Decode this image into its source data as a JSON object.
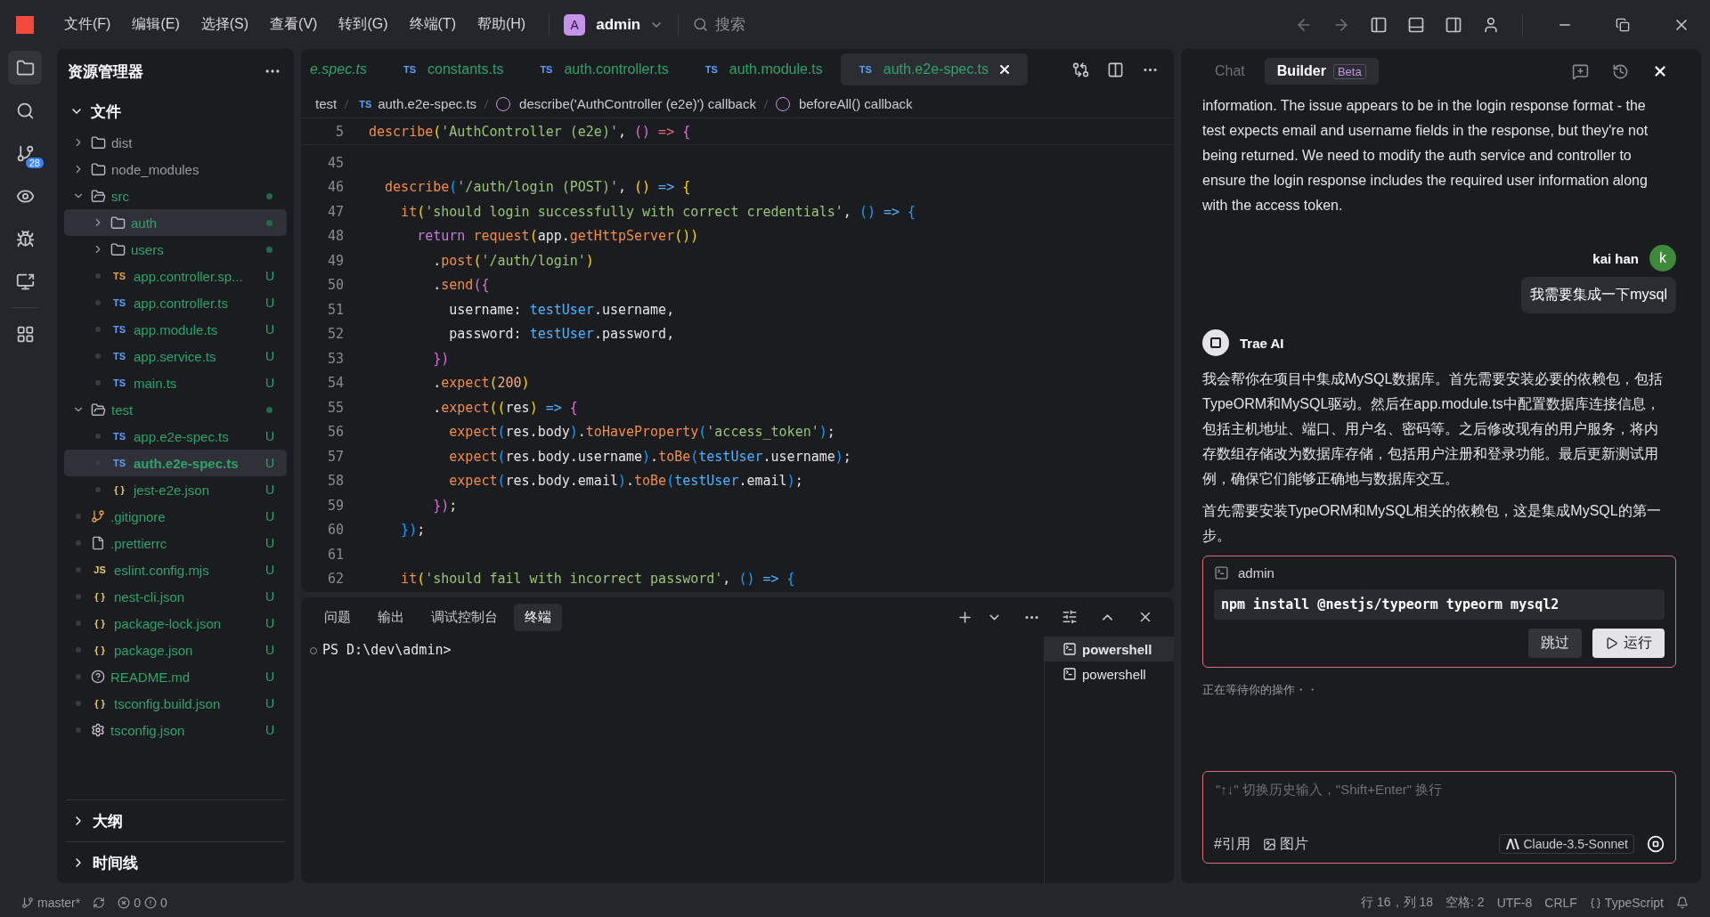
{
  "title_bar": {
    "menus": [
      "文件(F)",
      "编辑(E)",
      "选择(S)",
      "查看(V)",
      "转到(G)",
      "终端(T)",
      "帮助(H)"
    ],
    "project": {
      "avatar": "A",
      "name": "admin"
    },
    "search": {
      "placeholder": "搜索"
    }
  },
  "activity_bar": [
    {
      "kind": "files",
      "selected": true
    },
    {
      "kind": "search",
      "selected": false
    },
    {
      "kind": "git",
      "selected": false,
      "badge": "28"
    },
    {
      "kind": "watch",
      "selected": false
    },
    {
      "kind": "debug",
      "selected": false
    },
    {
      "kind": "remote",
      "selected": false
    },
    {
      "kind": "extensions",
      "selected": false
    }
  ],
  "explorer": {
    "title": "资源管理器",
    "sections": [
      {
        "label": "文件",
        "expanded": true,
        "items": [
          {
            "name": "dist",
            "kind": "folder",
            "expanded": false,
            "selected": false
          },
          {
            "name": "node_modules",
            "kind": "folder",
            "expanded": false,
            "selected": false
          },
          {
            "name": "src",
            "kind": "folder",
            "expanded": true,
            "selected": false,
            "dot": true,
            "children": [
              {
                "name": "auth",
                "kind": "folder",
                "expanded": false,
                "selected": true,
                "dot": true
              },
              {
                "name": "users",
                "kind": "folder",
                "expanded": false,
                "selected": false,
                "dot": true
              },
              {
                "name": "app.controller.sp...",
                "kind": "test",
                "icon": "TS",
                "selected": false,
                "badge": "U"
              },
              {
                "name": "app.controller.ts",
                "kind": "code",
                "icon": "TS",
                "selected": false,
                "badge": "U"
              },
              {
                "name": "app.module.ts",
                "kind": "code",
                "icon": "TS",
                "selected": false,
                "badge": "U"
              },
              {
                "name": "app.service.ts",
                "kind": "code",
                "icon": "TS",
                "selected": false,
                "badge": "U"
              },
              {
                "name": "main.ts",
                "kind": "code",
                "icon": "TS",
                "selected": false,
                "badge": "U"
              }
            ]
          },
          {
            "name": "test",
            "kind": "folder",
            "expanded": true,
            "selected": false,
            "dot": true,
            "children": [
              {
                "name": "app.e2e-spec.ts",
                "kind": "code",
                "icon": "TS",
                "selected": false,
                "badge": "U"
              },
              {
                "name": "auth.e2e-spec.ts",
                "kind": "code",
                "icon": "TS",
                "selected": true,
                "badge": "U"
              },
              {
                "name": "jest-e2e.json",
                "kind": "json",
                "icon": "{ }",
                "selected": false,
                "badge": "U"
              }
            ]
          },
          {
            "name": ".gitignore",
            "kind": "git",
            "selected": false,
            "badge": "U"
          },
          {
            "name": ".prettierrc",
            "kind": "file",
            "selected": false,
            "badge": "U"
          },
          {
            "name": "eslint.config.mjs",
            "kind": "json",
            "icon": "JS",
            "selected": false,
            "badge": "U"
          },
          {
            "name": "nest-cli.json",
            "kind": "json",
            "icon": "{ }",
            "selected": false,
            "badge": "U"
          },
          {
            "name": "package-lock.json",
            "kind": "json",
            "icon": "{ }",
            "selected": false,
            "badge": "U"
          },
          {
            "name": "package.json",
            "kind": "json",
            "icon": "{ }",
            "selected": false,
            "badge": "U"
          },
          {
            "name": "README.md",
            "kind": "readme",
            "selected": false,
            "badge": "U"
          },
          {
            "name": "tsconfig.build.json",
            "kind": "json",
            "icon": "{ }",
            "selected": false,
            "badge": "U"
          },
          {
            "name": "tsconfig.json",
            "kind": "gear",
            "selected": false,
            "badge": "U"
          }
        ]
      },
      {
        "label": "大纲",
        "expanded": false
      },
      {
        "label": "时间线",
        "expanded": false
      }
    ]
  },
  "editor": {
    "tabs": [
      {
        "label": "e.spec.ts",
        "selected": false
      },
      {
        "icon": "TS",
        "label": "constants.ts",
        "selected": false
      },
      {
        "icon": "TS",
        "label": "auth.controller.ts",
        "selected": false
      },
      {
        "icon": "TS",
        "label": "auth.module.ts",
        "selected": false
      },
      {
        "icon": "TS",
        "label": "auth.e2e-spec.ts",
        "selected": true
      }
    ],
    "breadcrumb": [
      {
        "kind": "folder",
        "label": "test"
      },
      {
        "kind": "file",
        "icon": "TS",
        "label": "auth.e2e-spec.ts"
      },
      {
        "kind": "function",
        "label": "describe('AuthController (e2e)') callback"
      },
      {
        "kind": "function",
        "label": "beforeAll() callback"
      }
    ],
    "sticky_line": {
      "num": "5",
      "tokens": [
        {
          "text": "describe",
          "kind": "fn"
        },
        {
          "text": "(",
          "kind": "b1"
        },
        {
          "text": "'AuthController (e2e)'",
          "kind": "str"
        },
        {
          "text": ", ",
          "kind": "plain"
        },
        {
          "text": "()",
          "kind": "b2"
        },
        {
          "text": " => ",
          "kind": "op"
        },
        {
          "text": "{",
          "kind": "b2"
        }
      ]
    },
    "lines": [
      {
        "num": "45"
      },
      {
        "num": "46",
        "tokens": [
          {
            "text": "  describe",
            "kind": "fn"
          },
          {
            "text": "(",
            "kind": "b3"
          },
          {
            "text": "'/auth/login (POST)'",
            "kind": "str"
          },
          {
            "text": ", ",
            "kind": "plain"
          },
          {
            "text": "()",
            "kind": "b1"
          },
          {
            "text": " => ",
            "kind": "var"
          },
          {
            "text": "{",
            "kind": "b1"
          }
        ]
      },
      {
        "num": "47",
        "tokens": [
          {
            "text": "    it",
            "kind": "fn"
          },
          {
            "text": "(",
            "kind": "b1"
          },
          {
            "text": "'should login successfully with correct credentials'",
            "kind": "str"
          },
          {
            "text": ", ",
            "kind": "plain"
          },
          {
            "text": "()",
            "kind": "b3"
          },
          {
            "text": " => ",
            "kind": "var"
          },
          {
            "text": "{",
            "kind": "b3"
          }
        ]
      },
      {
        "num": "48",
        "tokens": [
          {
            "text": "      return ",
            "kind": "kw"
          },
          {
            "text": "request",
            "kind": "fn"
          },
          {
            "text": "(",
            "kind": "b1"
          },
          {
            "text": "app.",
            "kind": "plain"
          },
          {
            "text": "getHttpServer",
            "kind": "fn"
          },
          {
            "text": "())",
            "kind": "b1"
          }
        ]
      },
      {
        "num": "49",
        "tokens": [
          {
            "text": "        .",
            "kind": "plain"
          },
          {
            "text": "post",
            "kind": "fn"
          },
          {
            "text": "(",
            "kind": "b1"
          },
          {
            "text": "'/auth/login'",
            "kind": "str"
          },
          {
            "text": ")",
            "kind": "b1"
          }
        ]
      },
      {
        "num": "50",
        "tokens": [
          {
            "text": "        .",
            "kind": "plain"
          },
          {
            "text": "send",
            "kind": "fn"
          },
          {
            "text": "({",
            "kind": "b2"
          }
        ]
      },
      {
        "num": "51",
        "tokens": [
          {
            "text": "          username: ",
            "kind": "plain"
          },
          {
            "text": "testUser",
            "kind": "var"
          },
          {
            "text": ".username,",
            "kind": "plain"
          }
        ]
      },
      {
        "num": "52",
        "tokens": [
          {
            "text": "          password: ",
            "kind": "plain"
          },
          {
            "text": "testUser",
            "kind": "var"
          },
          {
            "text": ".password,",
            "kind": "plain"
          }
        ]
      },
      {
        "num": "53",
        "tokens": [
          {
            "text": "        })",
            "kind": "b2"
          }
        ]
      },
      {
        "num": "54",
        "tokens": [
          {
            "text": "        .",
            "kind": "plain"
          },
          {
            "text": "expect",
            "kind": "fn"
          },
          {
            "text": "(",
            "kind": "b1"
          },
          {
            "text": "200",
            "kind": "num"
          },
          {
            "text": ")",
            "kind": "b1"
          }
        ]
      },
      {
        "num": "55",
        "tokens": [
          {
            "text": "        .",
            "kind": "plain"
          },
          {
            "text": "expect",
            "kind": "fn"
          },
          {
            "text": "((",
            "kind": "b1"
          },
          {
            "text": "res",
            "kind": "plain"
          },
          {
            "text": ")",
            "kind": "b1"
          },
          {
            "text": " => ",
            "kind": "var"
          },
          {
            "text": "{",
            "kind": "b2"
          }
        ]
      },
      {
        "num": "56",
        "tokens": [
          {
            "text": "          expect",
            "kind": "fn"
          },
          {
            "text": "(",
            "kind": "b3"
          },
          {
            "text": "res.body",
            "kind": "plain"
          },
          {
            "text": ")",
            "kind": "b3"
          },
          {
            "text": ".",
            "kind": "plain"
          },
          {
            "text": "toHaveProperty",
            "kind": "fn"
          },
          {
            "text": "(",
            "kind": "b3"
          },
          {
            "text": "'access_token'",
            "kind": "str"
          },
          {
            "text": ")",
            "kind": "b3"
          },
          {
            "text": ";",
            "kind": "plain"
          }
        ]
      },
      {
        "num": "57",
        "tokens": [
          {
            "text": "          expect",
            "kind": "fn"
          },
          {
            "text": "(",
            "kind": "b3"
          },
          {
            "text": "res.body.username",
            "kind": "plain"
          },
          {
            "text": ")",
            "kind": "b3"
          },
          {
            "text": ".",
            "kind": "plain"
          },
          {
            "text": "toBe",
            "kind": "fn"
          },
          {
            "text": "(",
            "kind": "b3"
          },
          {
            "text": "testUser",
            "kind": "var"
          },
          {
            "text": ".username",
            "kind": "plain"
          },
          {
            "text": ")",
            "kind": "b3"
          },
          {
            "text": ";",
            "kind": "plain"
          }
        ]
      },
      {
        "num": "58",
        "tokens": [
          {
            "text": "          expect",
            "kind": "fn"
          },
          {
            "text": "(",
            "kind": "b3"
          },
          {
            "text": "res.body.email",
            "kind": "plain"
          },
          {
            "text": ")",
            "kind": "b3"
          },
          {
            "text": ".",
            "kind": "plain"
          },
          {
            "text": "toBe",
            "kind": "fn"
          },
          {
            "text": "(",
            "kind": "b3"
          },
          {
            "text": "testUser",
            "kind": "var"
          },
          {
            "text": ".email",
            "kind": "plain"
          },
          {
            "text": ")",
            "kind": "b3"
          },
          {
            "text": ";",
            "kind": "plain"
          }
        ]
      },
      {
        "num": "59",
        "tokens": [
          {
            "text": "        })",
            "kind": "b2"
          },
          {
            "text": ";",
            "kind": "plain"
          }
        ]
      },
      {
        "num": "60",
        "tokens": [
          {
            "text": "    })",
            "kind": "b3"
          },
          {
            "text": ";",
            "kind": "plain"
          }
        ]
      },
      {
        "num": "61"
      },
      {
        "num": "62",
        "tokens": [
          {
            "text": "    it",
            "kind": "fn"
          },
          {
            "text": "(",
            "kind": "b1"
          },
          {
            "text": "'should fail with incorrect password'",
            "kind": "str"
          },
          {
            "text": ", ",
            "kind": "plain"
          },
          {
            "text": "()",
            "kind": "b3"
          },
          {
            "text": " => ",
            "kind": "var"
          },
          {
            "text": "{",
            "kind": "b3"
          }
        ]
      }
    ]
  },
  "panel": {
    "tabs": [
      {
        "label": "问题",
        "selected": false
      },
      {
        "label": "输出",
        "selected": false
      },
      {
        "label": "调试控制台",
        "selected": false
      },
      {
        "label": "终端",
        "selected": true
      }
    ],
    "prompt": "PS D:\\dev\\admin>",
    "terminals": [
      {
        "label": "powershell",
        "selected": true
      },
      {
        "label": "powershell",
        "selected": false
      }
    ]
  },
  "chat": {
    "tabs": [
      {
        "label": "Chat",
        "selected": false
      },
      {
        "label": "Builder",
        "badge": "Beta",
        "selected": true
      }
    ],
    "messages": [
      {
        "kind": "ai_text",
        "paragraphs": [
          "information. The issue appears to be in the login response format - the test expects email and username fields in the response, but they're not being returned. We need to modify the auth service and controller to ensure the login response includes the required user information along with the access token."
        ]
      },
      {
        "kind": "user",
        "name": "kai han",
        "avatar": "k",
        "text": "我需要集成一下mysql"
      },
      {
        "kind": "ai",
        "name": "Trae AI",
        "paragraphs": [
          "我会帮你在项目中集成MySQL数据库。首先需要安装必要的依赖包，包括TypeORM和MySQL驱动。然后在app.module.ts中配置数据库连接信息，包括主机地址、端口、用户名、密码等。之后修改现有的用户服务，将内存数组存储改为数据库存储，包括用户注册和登录功能。最后更新测试用例，确保它们能够正确地与数据库交互。",
          "首先需要安装TypeORM和MySQL相关的依赖包，这是集成MySQL的第一步。"
        ],
        "command": {
          "cwd": "admin",
          "text": "npm install @nestjs/typeorm typeorm mysql2",
          "skip": "跳过",
          "run": "运行"
        }
      }
    ],
    "status": "正在等待你的操作・・",
    "input": {
      "placeholder": "\"↑↓\" 切换历史输入，\"Shift+Enter\" 换行",
      "reference": "#引用",
      "image": "图片",
      "model": "Claude-3.5-Sonnet"
    }
  },
  "status_bar": {
    "branch": "master*",
    "errors": "0",
    "warnings": "0",
    "items": [
      "行 16，列 18",
      "空格: 2",
      "UTF-8",
      "CRLF",
      "TypeScript"
    ]
  }
}
